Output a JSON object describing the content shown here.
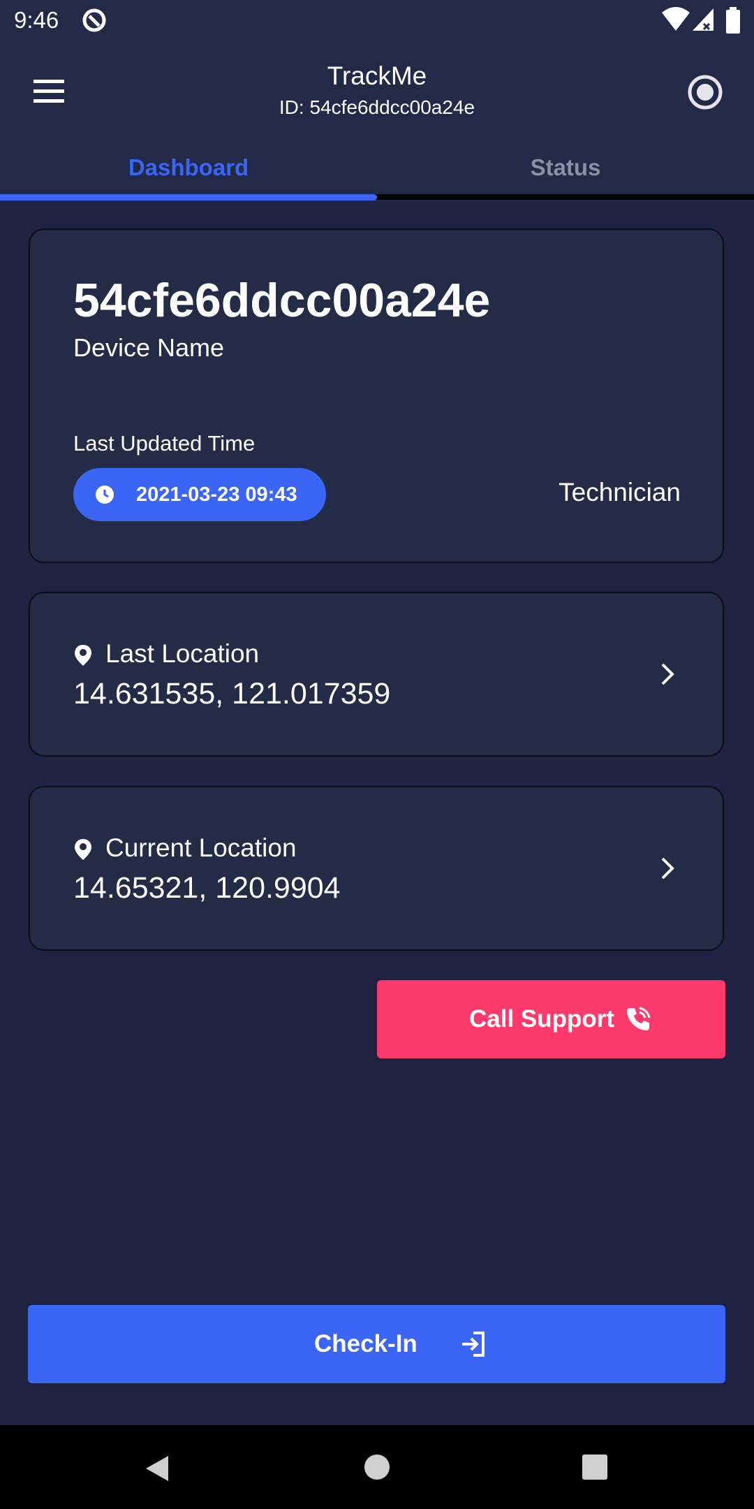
{
  "status_bar": {
    "time": "9:46"
  },
  "app_bar": {
    "title": "TrackMe",
    "subtitle": "ID: 54cfe6ddcc00a24e"
  },
  "tabs": [
    {
      "label": "Dashboard",
      "active": true
    },
    {
      "label": "Status",
      "active": false
    }
  ],
  "device_card": {
    "device_id": "54cfe6ddcc00a24e",
    "device_label": "Device Name",
    "updated_label": "Last Updated Time",
    "updated_time": "2021-03-23 09:43",
    "role": "Technician"
  },
  "last_location": {
    "label": "Last Location",
    "value": "14.631535, 121.017359"
  },
  "current_location": {
    "label": "Current Location",
    "value": "14.65321, 120.9904"
  },
  "call_support": {
    "label": "Call Support"
  },
  "check_in": {
    "label": "Check-In"
  },
  "colors": {
    "background": "#1f2240",
    "card": "#242b47",
    "accent": "#3b66f5",
    "danger": "#fd3a6c",
    "tab_inactive": "#8b90a5"
  },
  "icons": [
    "menu-icon",
    "record-icon",
    "clock-icon",
    "location-pin-icon",
    "chevron-right-icon",
    "phone-icon",
    "login-icon",
    "wifi-icon",
    "signal-icon",
    "battery-icon",
    "notification-icon"
  ]
}
